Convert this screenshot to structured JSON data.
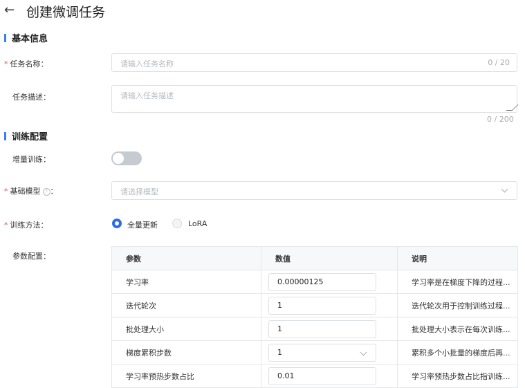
{
  "header": {
    "back_icon": "arrow-left-icon",
    "back_glyph": "←",
    "title": "创建微调任务"
  },
  "basic": {
    "section_title": "基本信息",
    "name_label": "任务名称：",
    "name_placeholder": "请输入任务名称",
    "name_counter": "0 / 20",
    "desc_label": "任务描述：",
    "desc_placeholder": "请输入任务描述",
    "desc_counter": "0 / 200"
  },
  "training": {
    "section_title": "训练配置",
    "incremental_label": "增量训练：",
    "incremental_on": false,
    "model_label": "基础模型",
    "model_colon": "：",
    "model_help_icon": "question-circle-icon",
    "model_placeholder": "请选择模型",
    "method_label": "训练方法：",
    "method_options": [
      "全量更新",
      "LoRA"
    ],
    "method_selected": "全量更新",
    "params_label": "参数配置："
  },
  "params_table": {
    "headers": [
      "参数",
      "数值",
      "说明"
    ],
    "rows": [
      {
        "name": "学习率",
        "value": "0.00000125",
        "type": "input",
        "desc": "学习率是在梯度下降的过程..."
      },
      {
        "name": "迭代轮次",
        "value": "1",
        "type": "input",
        "desc": "迭代轮次用于控制训练过程..."
      },
      {
        "name": "批处理大小",
        "value": "1",
        "type": "input",
        "desc": "批处理大小表示在每次训练..."
      },
      {
        "name": "梯度累积步数",
        "value": "1",
        "type": "select",
        "desc": "累积多个小批量的梯度后再..."
      },
      {
        "name": "学习率预热步数占比",
        "value": "0.01",
        "type": "input",
        "desc": "学习率预热步数占比指训练..."
      }
    ]
  }
}
